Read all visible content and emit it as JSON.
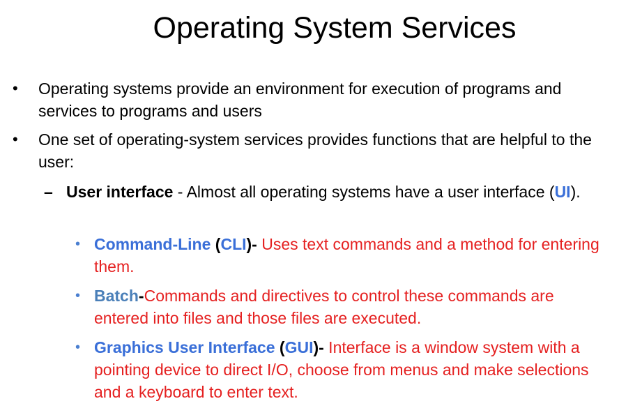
{
  "slide": {
    "title": "Operating System Services",
    "bullets": [
      "Operating systems provide an environment for execution of programs and services to programs and users",
      "One set of operating-system services provides functions that are helpful to the user:"
    ],
    "sub": {
      "marker": "–",
      "term": "User interface",
      "text": " - Almost all operating systems have a user interface (",
      "abbr": "UI",
      "close": ")."
    },
    "ui_types": [
      {
        "term": "Command-Line",
        "open": " (",
        "abbr": "CLI",
        "close": ")-",
        "desc": " Uses text commands and a method for entering them."
      },
      {
        "term": "Batch",
        "sep": "-",
        "desc": "Commands and directives to control these commands are entered into files and those files are executed."
      },
      {
        "term": "Graphics User Interface",
        "open": " (",
        "abbr": "GUI",
        "close": ")-",
        "desc": " Interface is a window system with a pointing device to direct I/O, choose from menus and make selections and a keyboard to enter text."
      }
    ],
    "colors": {
      "term_blue": "#3a6fd8",
      "desc_red": "#e52020",
      "bullet_blue": "#4a7fd0"
    }
  }
}
